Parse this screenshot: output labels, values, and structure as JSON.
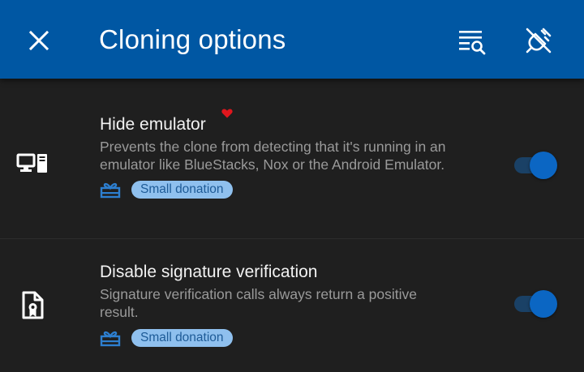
{
  "appbar": {
    "title": "Cloning options",
    "close_icon": "close-icon",
    "actions": [
      "filter-search-icon",
      "link-off-icon"
    ]
  },
  "options": [
    {
      "title": "Hide emulator",
      "description": "Prevents the clone from detecting that it's running in an emulator like BlueStacks, Nox or the Android Emulator.",
      "badge": "Small donation",
      "icon": "desktop-computer-icon",
      "enabled": true,
      "new_indicator": "heart-icon"
    },
    {
      "title": "Disable signature verification",
      "description": "Signature verification calls always return a positive result.",
      "badge": "Small donation",
      "icon": "certificate-file-icon",
      "enabled": true
    }
  ],
  "colors": {
    "appbar": "#0057a3",
    "background": "#1f1f1f",
    "badge_bg": "#8fc0ee",
    "badge_text": "#1e5b97",
    "toggle_thumb": "#0b66c3",
    "heart": "#e0161d"
  }
}
